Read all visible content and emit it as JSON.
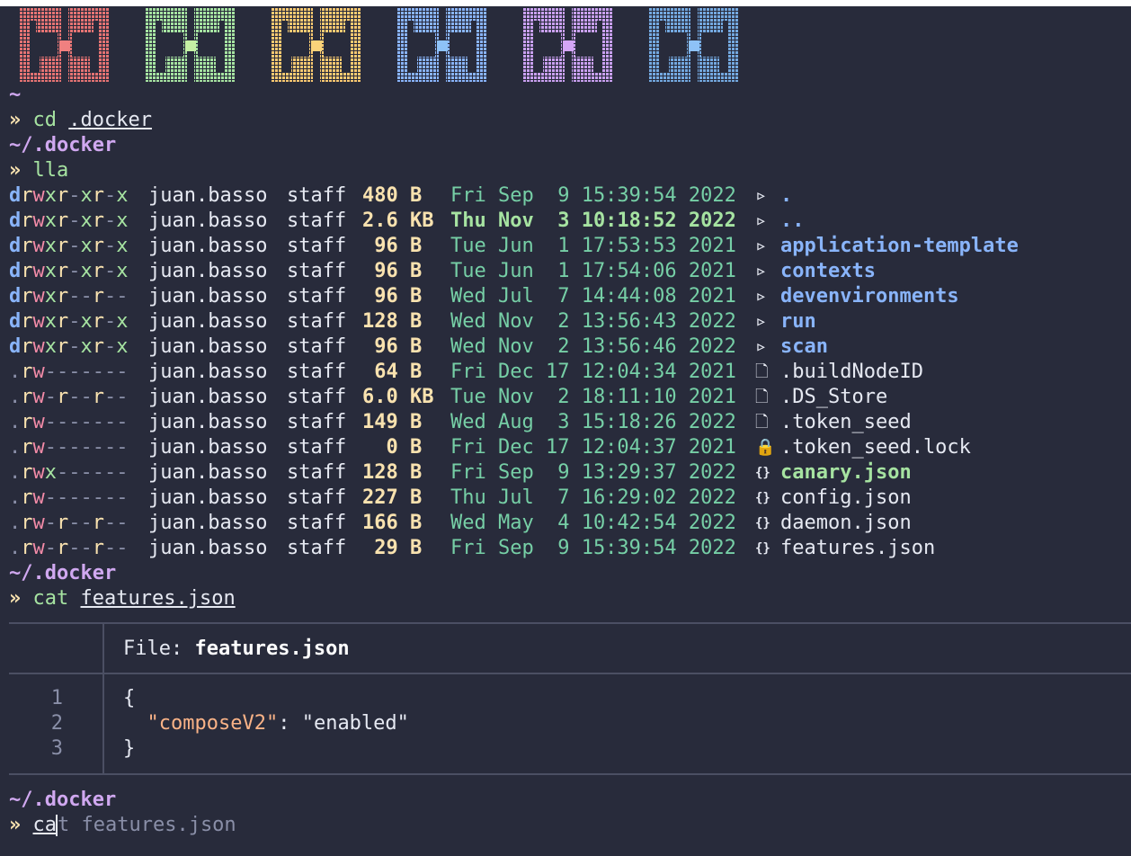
{
  "terminal": {
    "logos": [
      {
        "color": "#e57373",
        "accent": "#f08080"
      },
      {
        "color": "#a6e3a1",
        "accent": "#c5f0a4"
      },
      {
        "color": "#f9c971",
        "accent": "#fad37a"
      },
      {
        "color": "#89b4fa",
        "accent": "#8ec2f7"
      },
      {
        "color": "#c9a0f0",
        "accent": "#d4a5f5"
      },
      {
        "color": "#74a9e0",
        "accent": "#8ec2f7"
      }
    ],
    "home_path": "~",
    "prompt_symbol": "»",
    "cmd1": {
      "command": "cd",
      "arg": ".docker"
    },
    "cwd": "~/.docker",
    "cmd2": {
      "command": "lla"
    },
    "listing": [
      {
        "perm": [
          "d",
          "r",
          "w",
          "x",
          "r",
          "-",
          "x",
          "r",
          "-",
          "x"
        ],
        "user": "juan.basso",
        "group": "staff",
        "size": "480",
        "unit": "B",
        "date": "Fri Sep  9 15:39:54 2022",
        "fresh": false,
        "icon": "▹",
        "iconname": "folder-icon",
        "name": ".",
        "kind": "dir"
      },
      {
        "perm": [
          "d",
          "r",
          "w",
          "x",
          "r",
          "-",
          "x",
          "r",
          "-",
          "x"
        ],
        "user": "juan.basso",
        "group": "staff",
        "size": "2.6",
        "unit": "KB",
        "date": "Thu Nov  3 10:18:52 2022",
        "fresh": true,
        "icon": "▹",
        "iconname": "folder-icon",
        "name": "..",
        "kind": "dir"
      },
      {
        "perm": [
          "d",
          "r",
          "w",
          "x",
          "r",
          "-",
          "x",
          "r",
          "-",
          "x"
        ],
        "user": "juan.basso",
        "group": "staff",
        "size": " 96",
        "unit": "B",
        "date": "Tue Jun  1 17:53:53 2021",
        "fresh": false,
        "icon": "▹",
        "iconname": "folder-icon",
        "name": "application-template",
        "kind": "dir"
      },
      {
        "perm": [
          "d",
          "r",
          "w",
          "x",
          "r",
          "-",
          "x",
          "r",
          "-",
          "x"
        ],
        "user": "juan.basso",
        "group": "staff",
        "size": " 96",
        "unit": "B",
        "date": "Tue Jun  1 17:54:06 2021",
        "fresh": false,
        "icon": "▹",
        "iconname": "folder-icon",
        "name": "contexts",
        "kind": "dir"
      },
      {
        "perm": [
          "d",
          "r",
          "w",
          "x",
          "r",
          "-",
          "-",
          "r",
          "-",
          "-"
        ],
        "user": "juan.basso",
        "group": "staff",
        "size": " 96",
        "unit": "B",
        "date": "Wed Jul  7 14:44:08 2021",
        "fresh": false,
        "icon": "▹",
        "iconname": "folder-icon",
        "name": "devenvironments",
        "kind": "dir"
      },
      {
        "perm": [
          "d",
          "r",
          "w",
          "x",
          "r",
          "-",
          "x",
          "r",
          "-",
          "x"
        ],
        "user": "juan.basso",
        "group": "staff",
        "size": "128",
        "unit": "B",
        "date": "Wed Nov  2 13:56:43 2022",
        "fresh": false,
        "icon": "▹",
        "iconname": "folder-icon",
        "name": "run",
        "kind": "dir"
      },
      {
        "perm": [
          "d",
          "r",
          "w",
          "x",
          "r",
          "-",
          "x",
          "r",
          "-",
          "x"
        ],
        "user": "juan.basso",
        "group": "staff",
        "size": " 96",
        "unit": "B",
        "date": "Wed Nov  2 13:56:46 2022",
        "fresh": false,
        "icon": "▹",
        "iconname": "folder-icon",
        "name": "scan",
        "kind": "dir"
      },
      {
        "perm": [
          ".",
          "r",
          "w",
          "-",
          "-",
          "-",
          "-",
          "-",
          "-",
          "-"
        ],
        "user": "juan.basso",
        "group": "staff",
        "size": " 64",
        "unit": "B",
        "date": "Fri Dec 17 12:04:34 2021",
        "fresh": false,
        "icon": "🗋",
        "iconname": "file-icon",
        "name": ".buildNodeID",
        "kind": "file"
      },
      {
        "perm": [
          ".",
          "r",
          "w",
          "-",
          "r",
          "-",
          "-",
          "r",
          "-",
          "-"
        ],
        "user": "juan.basso",
        "group": "staff",
        "size": "6.0",
        "unit": "KB",
        "date": "Tue Nov  2 18:11:10 2021",
        "fresh": false,
        "icon": "🗋",
        "iconname": "file-icon",
        "name": ".DS_Store",
        "kind": "file"
      },
      {
        "perm": [
          ".",
          "r",
          "w",
          "-",
          "-",
          "-",
          "-",
          "-",
          "-",
          "-"
        ],
        "user": "juan.basso",
        "group": "staff",
        "size": "149",
        "unit": "B",
        "date": "Wed Aug  3 15:18:26 2022",
        "fresh": false,
        "icon": "🗋",
        "iconname": "file-icon",
        "name": ".token_seed",
        "kind": "file"
      },
      {
        "perm": [
          ".",
          "r",
          "w",
          "-",
          "-",
          "-",
          "-",
          "-",
          "-",
          "-"
        ],
        "user": "juan.basso",
        "group": "staff",
        "size": "  0",
        "unit": "B",
        "date": "Fri Dec 17 12:04:37 2021",
        "fresh": false,
        "icon": "🔒",
        "iconname": "lock-icon",
        "name": ".token_seed.lock",
        "kind": "file"
      },
      {
        "perm": [
          ".",
          "r",
          "w",
          "x",
          "-",
          "-",
          "-",
          "-",
          "-",
          "-"
        ],
        "user": "juan.basso",
        "group": "staff",
        "size": "128",
        "unit": "B",
        "date": "Fri Sep  9 13:29:37 2022",
        "fresh": false,
        "icon": "{}",
        "iconname": "json-icon",
        "name": "canary.json",
        "kind": "exec"
      },
      {
        "perm": [
          ".",
          "r",
          "w",
          "-",
          "-",
          "-",
          "-",
          "-",
          "-",
          "-"
        ],
        "user": "juan.basso",
        "group": "staff",
        "size": "227",
        "unit": "B",
        "date": "Thu Jul  7 16:29:02 2022",
        "fresh": false,
        "icon": "{}",
        "iconname": "json-icon",
        "name": "config.json",
        "kind": "file"
      },
      {
        "perm": [
          ".",
          "r",
          "w",
          "-",
          "r",
          "-",
          "-",
          "r",
          "-",
          "-"
        ],
        "user": "juan.basso",
        "group": "staff",
        "size": "166",
        "unit": "B",
        "date": "Wed May  4 10:42:54 2022",
        "fresh": false,
        "icon": "{}",
        "iconname": "json-icon",
        "name": "daemon.json",
        "kind": "file"
      },
      {
        "perm": [
          ".",
          "r",
          "w",
          "-",
          "r",
          "-",
          "-",
          "r",
          "-",
          "-"
        ],
        "user": "juan.basso",
        "group": "staff",
        "size": " 29",
        "unit": "B",
        "date": "Fri Sep  9 15:39:54 2022",
        "fresh": false,
        "icon": "{}",
        "iconname": "json-icon",
        "name": "features.json",
        "kind": "file"
      }
    ],
    "cmd3": {
      "command": "cat",
      "arg": "features.json"
    },
    "bat": {
      "file_label": "File: ",
      "file_name": "features.json",
      "lines": [
        {
          "num": "1",
          "text": "{"
        },
        {
          "num": "2",
          "key": "\"composeV2\"",
          "sep": ": ",
          "value": "\"enabled\""
        },
        {
          "num": "3",
          "text": "}"
        }
      ]
    },
    "input": {
      "typed": "ca",
      "rest": "t features.json"
    }
  }
}
